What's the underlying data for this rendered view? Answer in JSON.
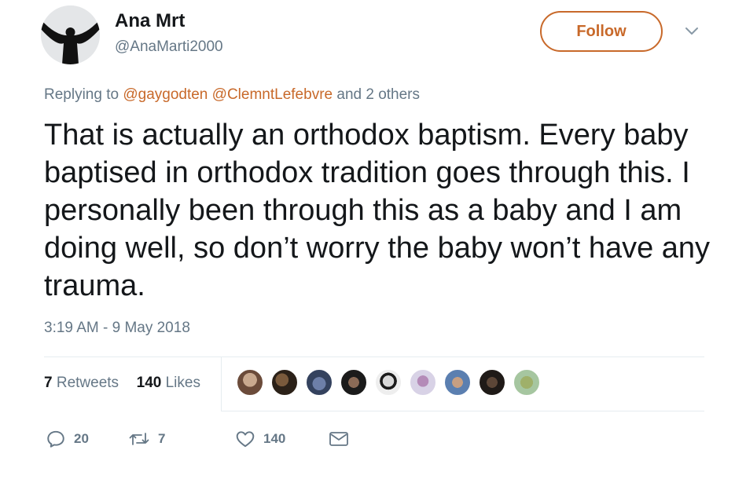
{
  "tweet": {
    "author_name": "Ana Mrt",
    "author_handle": "@AnaMarti2000",
    "follow_label": "Follow",
    "replying_prefix": "Replying to",
    "mention_1": "@gaygodten",
    "mention_2": "@ClemntLefebvre",
    "replying_suffix": "and 2 others",
    "text": "That is actually an orthodox baptism. Every baby baptised in orthodox tradition goes through this. I personally been through this as a baby and I am doing well, so don’t worry the baby won’t have any trauma.",
    "timestamp": "3:19 AM - 9 May 2018"
  },
  "stats": {
    "retweets_count": "7",
    "retweets_label": "Retweets",
    "likes_count": "140",
    "likes_label": "Likes"
  },
  "actions": {
    "reply_count": "20",
    "retweet_count": "7",
    "like_count": "140"
  },
  "colors": {
    "accent": "#c8692a",
    "secondary_text": "#657786",
    "primary_text": "#14171a",
    "divider": "#e6ecf0"
  }
}
